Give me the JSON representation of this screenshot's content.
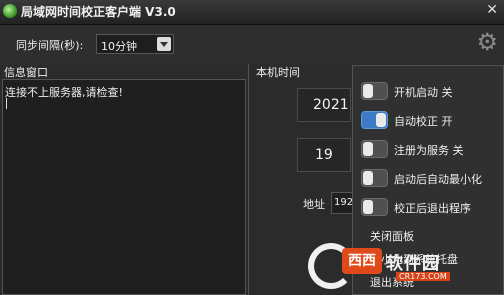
{
  "window": {
    "title": "局域网时间校正客户端 V3.0",
    "close_glyph": "✕"
  },
  "toolbar": {
    "sync_label": "同步间隔(秒):",
    "sync_value": "10分钟",
    "settings_icon": "gear-icon"
  },
  "info": {
    "label": "信息窗口",
    "message": "连接不上服务器,请检查!"
  },
  "clock": {
    "label": "本机时间",
    "year": "2021",
    "day": "19",
    "address_label": "地址",
    "address_value": "192"
  },
  "menu": {
    "items": [
      {
        "label": "开机启动 关",
        "on": false
      },
      {
        "label": "自动校正 开",
        "on": true
      },
      {
        "label": "注册为服务 关",
        "on": false
      },
      {
        "label": "启动后自动最小化",
        "on": false
      },
      {
        "label": "校正后退出程序",
        "on": false
      }
    ],
    "close_panel": "关闭面板",
    "minimize_tray": "最小化到系统托盘",
    "exit": "退出系统"
  },
  "watermark": {
    "logo": "西西",
    "text": "软件园",
    "sub": "CR173.COM"
  },
  "colors": {
    "switch_on": "#3d7bc4",
    "watermark": "#e04a1a"
  }
}
